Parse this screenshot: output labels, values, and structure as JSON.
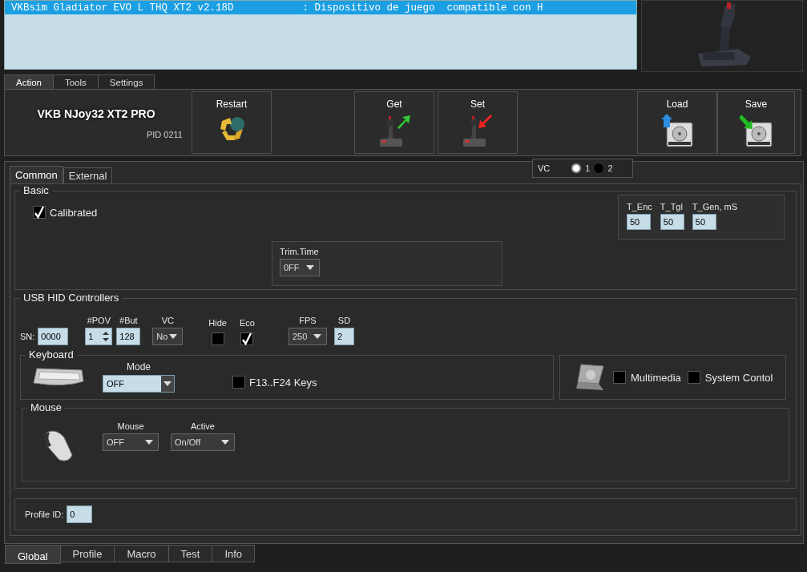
{
  "device_list": {
    "rows": [
      {
        "name": "VKBsim Gladiator EVO L THQ XT2 v2.18D",
        "description": ": Dispositivo de juego  compatible con H",
        "selected": true
      }
    ]
  },
  "top_tabs": [
    {
      "label": "Action",
      "selected": true
    },
    {
      "label": "Tools",
      "selected": false
    },
    {
      "label": "Settings",
      "selected": false
    }
  ],
  "action_panel": {
    "device_name": "VKB NJoy32 XT2 PRO",
    "pid": "PID 0211",
    "buttons": [
      {
        "label": "Restart",
        "kind": "restart"
      },
      {
        "label": "Get",
        "kind": "get"
      },
      {
        "label": "Set",
        "kind": "set"
      },
      {
        "label": "Load",
        "kind": "load"
      },
      {
        "label": "Save",
        "kind": "save"
      }
    ]
  },
  "sub_tabs": [
    {
      "label": "Common",
      "selected": true
    },
    {
      "label": "External",
      "selected": false
    }
  ],
  "vc_selector": {
    "label": "VC",
    "options": [
      {
        "label": "1",
        "selected": true
      },
      {
        "label": "2",
        "selected": false
      }
    ]
  },
  "basic": {
    "title": "Basic",
    "calibrated": {
      "label": "Calibrated",
      "checked": true
    },
    "timers": [
      {
        "label": "T_Enc",
        "value": "50"
      },
      {
        "label": "T_Tgl",
        "value": "50"
      },
      {
        "label": "T_Gen, mS",
        "value": "50"
      }
    ],
    "trim_time": {
      "label": "Trim.Time",
      "value": "0FF"
    }
  },
  "usb_hid": {
    "title": "USB HID Controllers",
    "sn": {
      "label": "SN:",
      "value": "0000"
    },
    "pov": {
      "label": "#POV",
      "value": "1"
    },
    "buttons": {
      "label": "#But",
      "value": "128"
    },
    "vc": {
      "label": "VC",
      "value": "No"
    },
    "hide": {
      "label": "Hide",
      "checked": false
    },
    "eco": {
      "label": "Eco",
      "checked": true
    },
    "fps": {
      "label": "FPS",
      "value": "250"
    },
    "sd": {
      "label": "SD",
      "value": "2"
    },
    "keyboard": {
      "title": "Keyboard",
      "mode_label": "Mode",
      "mode_value": "OFF",
      "f_keys": {
        "label": "F13..F24 Keys",
        "checked": false
      }
    },
    "media": {
      "multimedia": {
        "label": "Multimedia",
        "checked": false
      },
      "system_control": {
        "label": "System Contol",
        "checked": false
      }
    },
    "mouse": {
      "title": "Mouse",
      "mouse": {
        "label": "Mouse",
        "value": "OFF"
      },
      "active": {
        "label": "Active",
        "value": "On/Off"
      }
    }
  },
  "profile": {
    "label": "Profile ID:",
    "value": "0"
  },
  "bottom_tabs": [
    {
      "label": "Global",
      "selected": true
    },
    {
      "label": "Profile",
      "selected": false
    },
    {
      "label": "Macro",
      "selected": false
    },
    {
      "label": "Test",
      "selected": false
    },
    {
      "label": "Info",
      "selected": false
    }
  ]
}
